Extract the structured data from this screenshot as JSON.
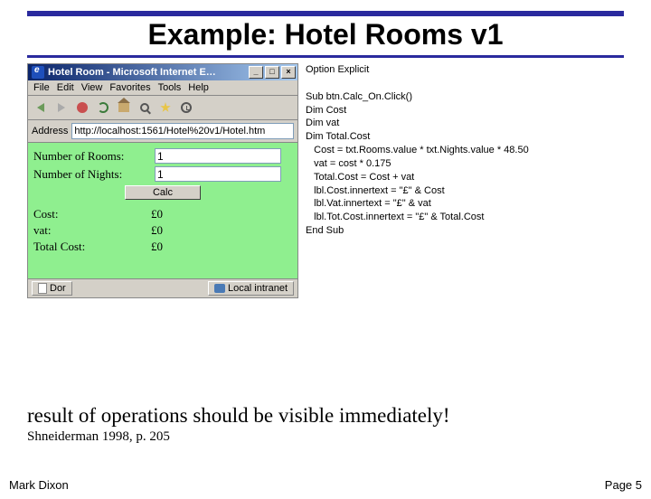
{
  "slide": {
    "title": "Example: Hotel Rooms v1",
    "result_text": "result of operations should be visible immediately!",
    "citation": "Shneiderman 1998, p. 205",
    "author": "Mark Dixon",
    "page": "Page 5"
  },
  "browser": {
    "window_title": "Hotel Room - Microsoft Internet E…",
    "menu": {
      "file": "File",
      "edit": "Edit",
      "view": "View",
      "favorites": "Favorites",
      "tools": "Tools",
      "help": "Help"
    },
    "address_label": "Address",
    "address_value": "http://localhost:1561/Hotel%20v1/Hotel.htm",
    "status_left": "Dor",
    "status_right": "Local intranet"
  },
  "form": {
    "rooms_label": "Number of Rooms:",
    "rooms_value": "1",
    "nights_label": "Number of Nights:",
    "nights_value": "1",
    "calc_label": "Calc",
    "cost_label": "Cost:",
    "cost_value": "£0",
    "vat_label": "vat:",
    "vat_value": "£0",
    "total_label": "Total Cost:",
    "total_value": "£0"
  },
  "code": {
    "l1": "Option Explicit",
    "l2": "",
    "l3": "Sub btn.Calc_On.Click()",
    "l4": "Dim Cost",
    "l5": "Dim vat",
    "l6": "Dim Total.Cost",
    "l7": "   Cost = txt.Rooms.value * txt.Nights.value * 48.50",
    "l8": "   vat = cost * 0.175",
    "l9": "   Total.Cost = Cost + vat",
    "l10": "   lbl.Cost.innertext = \"£\" & Cost",
    "l11": "   lbl.Vat.innertext = \"£\" & vat",
    "l12": "   lbl.Tot.Cost.innertext = \"£\" & Total.Cost",
    "l13": "End Sub"
  }
}
